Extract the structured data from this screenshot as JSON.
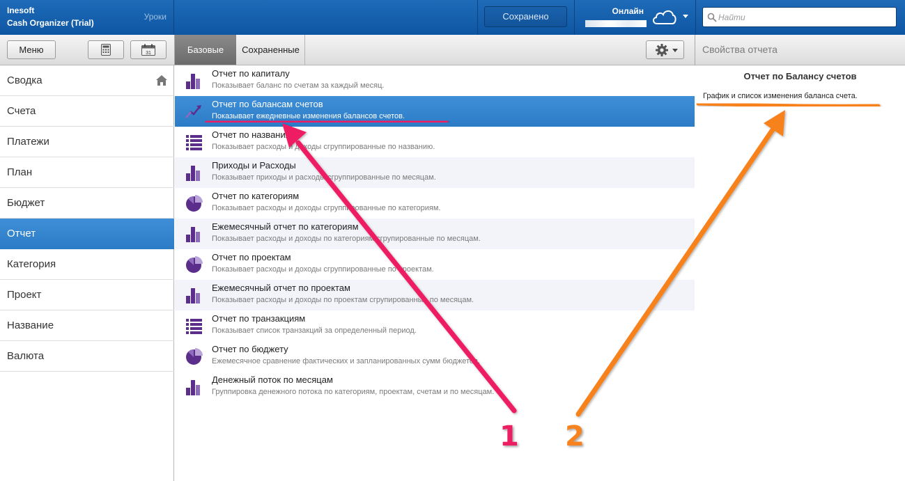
{
  "app": {
    "company": "Inesoft",
    "product": "Cash Organizer (Trial)",
    "lessons_label": "Уроки"
  },
  "topbar": {
    "saved_label": "Сохранено",
    "online_label": "Онлайн",
    "search_placeholder": "Найти"
  },
  "toolbar": {
    "menu_label": "Меню",
    "calendar_day": "31",
    "tabs": [
      {
        "label": "Базовые",
        "active": true
      },
      {
        "label": "Сохраненные",
        "active": false
      }
    ]
  },
  "sidebar": {
    "items": [
      {
        "label": "Сводка",
        "icon": "home-icon"
      },
      {
        "label": "Счета"
      },
      {
        "label": "Платежи"
      },
      {
        "label": "План"
      },
      {
        "label": "Бюджет"
      },
      {
        "label": "Отчет",
        "active": true
      },
      {
        "label": "Категория"
      },
      {
        "label": "Проект"
      },
      {
        "label": "Название"
      },
      {
        "label": "Валюта"
      }
    ]
  },
  "reports": [
    {
      "title": "Отчет по капиталу",
      "desc": "Показывает баланс по счетам за каждый месяц.",
      "icon": "bar-chart-icon"
    },
    {
      "title": "Отчет по балансам счетов",
      "desc": "Показывает ежедневные изменения балансов счетов.",
      "icon": "line-chart-icon",
      "selected": true
    },
    {
      "title": "Отчет по названиям",
      "desc": "Показывает расходы и доходы сгруппированные по названию.",
      "icon": "list-icon"
    },
    {
      "title": "Приходы и Расходы",
      "desc": "Показывает приходы и расходы сгруппированные по месяцам.",
      "icon": "bar-chart-icon"
    },
    {
      "title": "Отчет по категориям",
      "desc": "Показывает расходы и доходы сгруппированные по категориям.",
      "icon": "pie-chart-icon"
    },
    {
      "title": "Ежемесячный отчет по категориям",
      "desc": "Показывает расходы и доходы по категориям сгрупированные по месяцам.",
      "icon": "bar-chart-icon"
    },
    {
      "title": "Отчет по проектам",
      "desc": "Показывает расходы и доходы сгруппированные по проектам.",
      "icon": "pie-chart-icon"
    },
    {
      "title": "Ежемесячный отчет по проектам",
      "desc": "Показывает расходы и доходы по проектам сгрупированные по месяцам.",
      "icon": "bar-chart-icon"
    },
    {
      "title": "Отчет по транзакциям",
      "desc": "Показывает список транзакций за определенный период.",
      "icon": "list-icon"
    },
    {
      "title": "Отчет по бюджету",
      "desc": "Ежемесячное сравнение фактических и запланированных сумм бюджетов.",
      "icon": "pie-chart-icon"
    },
    {
      "title": "Денежный поток по месяцам",
      "desc": "Группировка денежного потока по категориям, проектам, счетам и по месяцам.",
      "icon": "bar-chart-icon"
    }
  ],
  "properties": {
    "panel_title": "Свойства отчета",
    "heading": "Отчет по Балансу счетов",
    "description": "График и список изменения баланса счета."
  },
  "annotations": {
    "label_1": "1",
    "label_2": "2",
    "color_1": "#ee1e63",
    "color_2": "#f7821e"
  },
  "colors": {
    "topbar": "#0d56a3",
    "selection": "#3a89d3",
    "icon_purple": "#5b2e8c"
  }
}
